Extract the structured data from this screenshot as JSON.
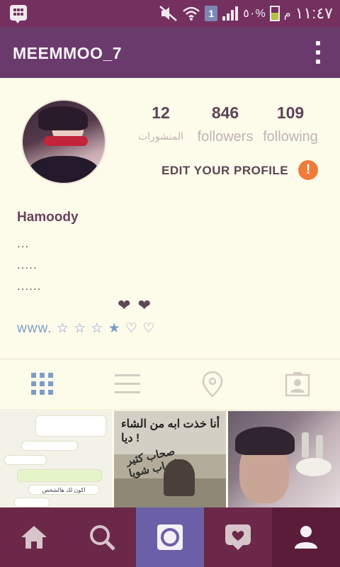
{
  "status_bar": {
    "time": "١١:٤٧",
    "am_pm": "م",
    "battery_percent": "٥٠%",
    "sim_badge": "1",
    "icons": [
      "bbm-icon",
      "mute-icon",
      "wifi-icon",
      "sim-icon",
      "signal-icon",
      "battery-icon"
    ]
  },
  "header": {
    "title": "MEEMMOO_7",
    "menu_icon": "more-vertical-icon"
  },
  "profile": {
    "name": "Hamoody",
    "stats": {
      "posts_count": "12",
      "posts_label": "المنشورات",
      "followers_count": "846",
      "followers_label": "followers",
      "following_count": "109",
      "following_label": "following"
    },
    "edit_label": "EDIT YOUR PROFILE",
    "alert_badge": "!",
    "bio_lines": [
      "...",
      ".....",
      "......"
    ],
    "hearts": "❤ ❤",
    "website": "www. ☆ ☆ ☆ ★ ♡ ♡"
  },
  "tabs": [
    "grid-icon",
    "list-icon",
    "location-pin-icon",
    "tagged-person-icon"
  ],
  "photos": {
    "photo_1_chat_text": "اكون لك هالشخص",
    "photo_2_caption_top": "أنا خذت ابه من الشاء ديا !",
    "photo_2_caption_bottom": "صحاب كثير احباب شويا"
  },
  "bottom_nav": [
    "home-icon",
    "search-icon",
    "camera-icon",
    "activity-heart-icon",
    "profile-icon"
  ],
  "colors": {
    "status_bar": "#74305f",
    "header": "#6a3a6c",
    "background": "#fdfbea",
    "accent_orange": "#f07a3a",
    "link_blue": "#7d9dc8",
    "bottom_nav": "#6b2848",
    "camera_tab": "#6b60a8"
  }
}
